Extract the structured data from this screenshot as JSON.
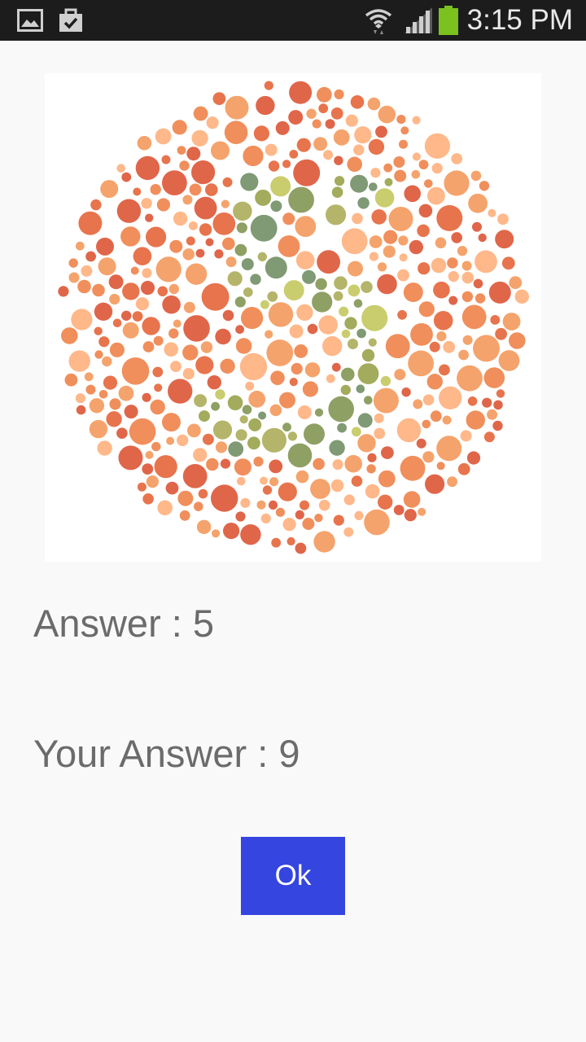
{
  "status_bar": {
    "time": "3:15 PM",
    "icons": [
      "gallery-notification-icon",
      "clipboard-notification-icon",
      "wifi-icon",
      "cellular-signal-icon",
      "battery-icon"
    ],
    "background": "#1c1c1c",
    "battery_color": "#7bc21f"
  },
  "plate": {
    "icon": "ishihara-color-plate",
    "hidden_digit": "5",
    "colors": {
      "background": [
        "#e7744d",
        "#f5a36c",
        "#ffb88a",
        "#f08f5c",
        "#e0664a"
      ],
      "figure": [
        "#8ea064",
        "#a3ab5c",
        "#c9cd6e",
        "#7f9a74",
        "#b4b56a"
      ]
    }
  },
  "result": {
    "answer_label": "Answer : 5",
    "your_answer_label": "Your Answer : 9"
  },
  "ok_button": {
    "label": "Ok",
    "color": "#3445e0"
  }
}
